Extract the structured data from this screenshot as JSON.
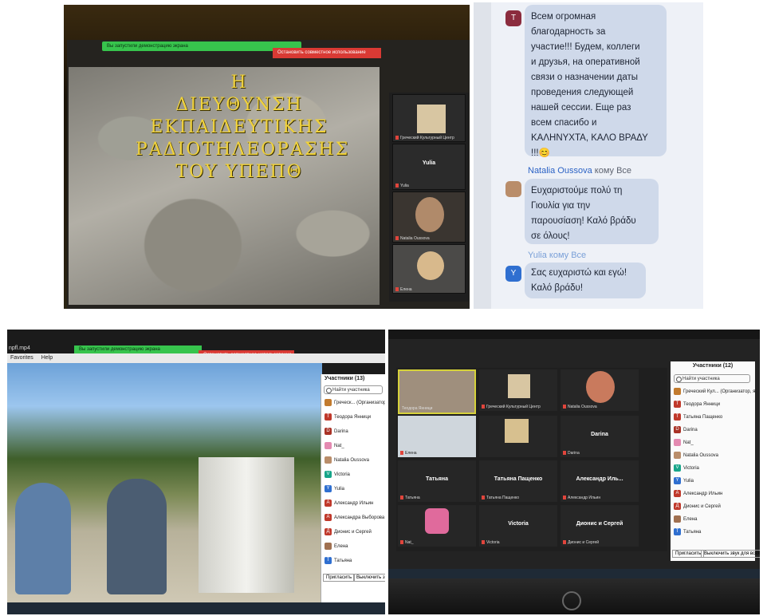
{
  "panel1": {
    "notice": "Вы запустили демонстрацию экрана",
    "stop_share": "Остановить совместное использование",
    "title": "Η\nΔΙΕΥΘΥΝΣΗ\nΕΚΠΑΙΔΕΥΤΙΚΗΣ\nΡΑΔΙΟΤΗΛΕΟΡΑΣΗΣ\nΤΟΥ ΥΠΕΠΘ",
    "tiles": [
      "Греческий Культурный Центр",
      "Yulia",
      "Yulia",
      "Natalia Oussova",
      "Елена"
    ]
  },
  "panel2": {
    "messages": [
      {
        "avatar": "T",
        "avatar_color": "#8b2c3e",
        "sender": "",
        "to": "",
        "text": "Всем огромная\nблагодарность за\nучастие!!! Будем, коллеги\nи друзья, на оперативной\nсвязи о назначении даты\nпроведения следующей\nнашей сессии. Еще раз\nвсем спасибо и\nΚΑΛΗΝΥΧΤΑ, ΚΑΛΟ ΒΡΑΔΥ\n!!!😊"
      },
      {
        "avatar": "",
        "avatar_color": "#b98d6a",
        "sender": "Natalia Oussova",
        "to": "кому Все",
        "text": "Ευχαριστούμε πολύ τη\nΓιουλία για την\nπαρουσίαση! Καλό βράδυ\nσε όλους!"
      },
      {
        "avatar": "Y",
        "avatar_color": "#2f6fd0",
        "sender": "Yulia",
        "to": "кому Все",
        "text": "Σας ευχαριστώ και εγώ!\nΚαλό βράδυ!"
      }
    ]
  },
  "panel3": {
    "notice": "Вы запустили демонстрацию экрана",
    "stop_share": "Остановить совместное использование",
    "file": "npfl.mp4",
    "menu": [
      "Favorites",
      "Help"
    ],
    "participants_title": "Участники (13)",
    "search": "Найти участника",
    "participants": [
      {
        "initial": "",
        "color": "#c27b2e",
        "name": "Греческ... (Организатор, я)"
      },
      {
        "initial": "T",
        "color": "#c0392b",
        "name": "Теодора Янници"
      },
      {
        "initial": "D",
        "color": "#a93226",
        "name": "Darina"
      },
      {
        "initial": "",
        "color": "#e48ab1",
        "name": "Nat_"
      },
      {
        "initial": "",
        "color": "#b98d6a",
        "name": "Natalia Oussova"
      },
      {
        "initial": "V",
        "color": "#17a589",
        "name": "Victoria"
      },
      {
        "initial": "Y",
        "color": "#2f6fd0",
        "name": "Yulia"
      },
      {
        "initial": "A",
        "color": "#c0392b",
        "name": "Александр Ильин"
      },
      {
        "initial": "A",
        "color": "#c0392b",
        "name": "Александра Выборова"
      },
      {
        "initial": "Д",
        "color": "#c0392b",
        "name": "Дионис и Сергей"
      },
      {
        "initial": "",
        "color": "#a07050",
        "name": "Елена"
      },
      {
        "initial": "T",
        "color": "#2f6fd0",
        "name": "Татьяна"
      }
    ],
    "invite": "Пригласить",
    "mute_all": "Выключить звук для"
  },
  "panel4": {
    "participants_title": "Участники (12)",
    "search": "Найти участника",
    "tiles": [
      {
        "name": "Теодора Янници",
        "label": ""
      },
      {
        "name": "Греческий Культурный Центр",
        "label": ""
      },
      {
        "name": "Natalia Oussova",
        "label": ""
      },
      {
        "name": "Елена",
        "label": ""
      },
      {
        "name": "Darina",
        "label": "Darina"
      },
      {
        "name": "Татьяна",
        "label": "Татьяна"
      },
      {
        "name": "Татьяна Пащенко",
        "label": "Татьяна Пащенко"
      },
      {
        "name": "Александр Ильин",
        "label": "Александр Иль..."
      },
      {
        "name": "Nat_",
        "label": ""
      },
      {
        "name": "Victoria",
        "label": "Victoria"
      },
      {
        "name": "Дионис и Сергей",
        "label": "Дионис и Сергей"
      }
    ],
    "participants": [
      {
        "initial": "",
        "color": "#c27b2e",
        "name": "Греческий Кул... (Организатор, я)"
      },
      {
        "initial": "T",
        "color": "#c0392b",
        "name": "Теодора Янници"
      },
      {
        "initial": "T",
        "color": "#c0392b",
        "name": "Татьяна Пащенко"
      },
      {
        "initial": "D",
        "color": "#a93226",
        "name": "Darina"
      },
      {
        "initial": "",
        "color": "#e48ab1",
        "name": "Nat_"
      },
      {
        "initial": "",
        "color": "#b98d6a",
        "name": "Natalia Oussova"
      },
      {
        "initial": "V",
        "color": "#17a589",
        "name": "Victoria"
      },
      {
        "initial": "Y",
        "color": "#2f6fd0",
        "name": "Yulia"
      },
      {
        "initial": "A",
        "color": "#c0392b",
        "name": "Александр Ильин"
      },
      {
        "initial": "Д",
        "color": "#c0392b",
        "name": "Дионис и Сергей"
      },
      {
        "initial": "",
        "color": "#a07050",
        "name": "Елена"
      },
      {
        "initial": "T",
        "color": "#2f6fd0",
        "name": "Татьяна"
      }
    ],
    "invite": "Пригласить",
    "mute_all": "Выключить звук для всех"
  }
}
